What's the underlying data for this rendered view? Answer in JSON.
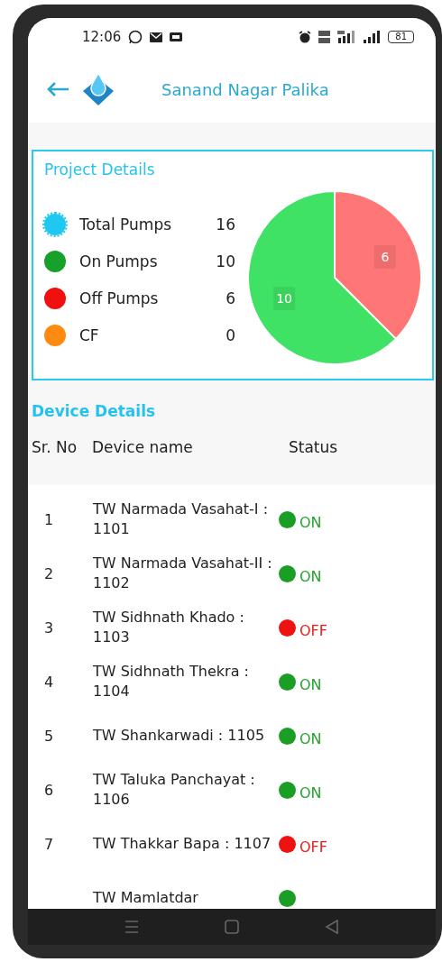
{
  "status_bar": {
    "time": "12:06",
    "battery": "81"
  },
  "header": {
    "title": "Sanand Nagar Palika"
  },
  "project": {
    "title": "Project Details",
    "stats": [
      {
        "kind": "total",
        "label": "Total Pumps",
        "value": "16",
        "color": "#1ec8f0"
      },
      {
        "kind": "on",
        "label": "On Pumps",
        "value": "10",
        "color": "#17a02a"
      },
      {
        "kind": "off",
        "label": "Off Pumps",
        "value": "6",
        "color": "#f01010"
      },
      {
        "kind": "cf",
        "label": "CF",
        "value": "0",
        "color": "#ff8a10"
      }
    ],
    "chart_data": {
      "type": "pie",
      "values": [
        6,
        10
      ],
      "colors": [
        "#ff7676",
        "#3fe264"
      ],
      "value_labels": [
        "6",
        "10"
      ]
    }
  },
  "devices": {
    "title": "Device Details",
    "columns": [
      "Sr. No",
      "Device name",
      "Status"
    ],
    "rows": [
      {
        "sr": "1",
        "name": "TW Narmada Vasahat-I : 1101",
        "on": true,
        "label": "ON"
      },
      {
        "sr": "2",
        "name": "TW Narmada Vasahat-II : 1102",
        "on": true,
        "label": "ON"
      },
      {
        "sr": "3",
        "name": "TW Sidhnath Khado  : 1103",
        "on": false,
        "label": "OFF"
      },
      {
        "sr": "4",
        "name": "TW Sidhnath Thekra : 1104",
        "on": true,
        "label": "ON"
      },
      {
        "sr": "5",
        "name": "TW Shankarwadi : 1105",
        "on": true,
        "label": "ON"
      },
      {
        "sr": "6",
        "name": "TW Taluka Panchayat : 1106",
        "on": true,
        "label": "ON"
      },
      {
        "sr": "7",
        "name": "TW Thakkar Bapa : 1107",
        "on": false,
        "label": "OFF"
      },
      {
        "name": "TW Mamlatdar",
        "on": true
      }
    ]
  }
}
